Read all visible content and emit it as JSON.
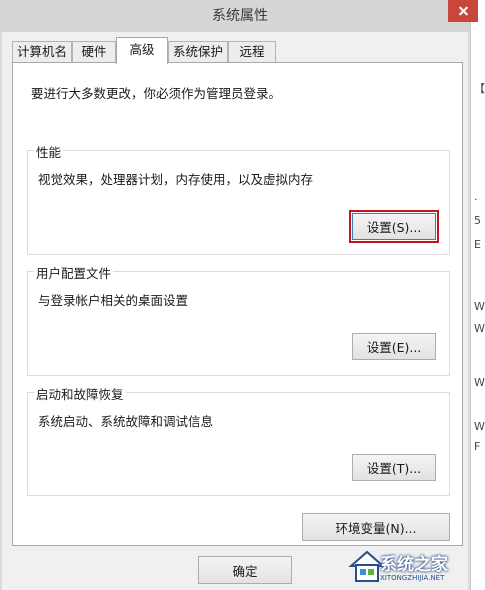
{
  "window": {
    "title": "系统属性"
  },
  "tabs": [
    {
      "label": "计算机名"
    },
    {
      "label": "硬件"
    },
    {
      "label": "高级"
    },
    {
      "label": "系统保护"
    },
    {
      "label": "远程"
    }
  ],
  "advanced": {
    "intro": "要进行大多数更改，你必须作为管理员登录。",
    "performance": {
      "title": "性能",
      "description": "视觉效果，处理器计划，内存使用，以及虚拟内存",
      "settings_button": "设置(S)..."
    },
    "user_profiles": {
      "title": "用户配置文件",
      "description": "与登录帐户相关的桌面设置",
      "settings_button": "设置(E)..."
    },
    "startup_recovery": {
      "title": "启动和故障恢复",
      "description": "系统启动、系统故障和调试信息",
      "settings_button": "设置(T)..."
    },
    "env_button": "环境变量(N)..."
  },
  "footer": {
    "ok_button": "确定"
  },
  "watermark": {
    "brand": "系统之家",
    "url": "XITONGZHIJIA.NET"
  },
  "background_chars": [
    "【",
    ".",
    "5",
    "E",
    "W",
    "W",
    "W",
    "W",
    "F"
  ],
  "colors": {
    "highlight": "#c4141e",
    "close": "#c9463d",
    "watermark_blue": "#2a4e8a"
  }
}
